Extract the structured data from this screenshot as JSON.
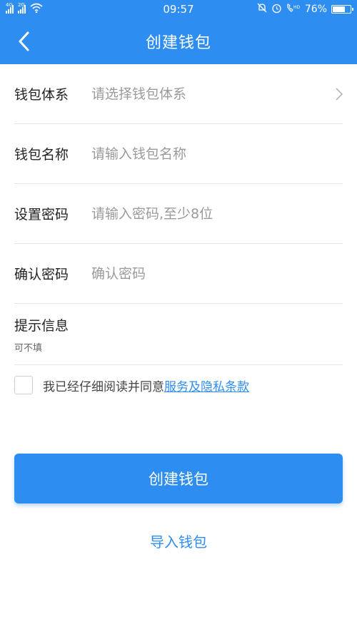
{
  "status_bar": {
    "signal_1": "4G",
    "signal_2": "2G",
    "time": "09:57",
    "battery_percent": "76%",
    "battery_level": 0.76,
    "icons": [
      "wifi-icon",
      "mute-bell-icon",
      "alarm-icon",
      "hd-call-icon",
      "battery-icon"
    ]
  },
  "nav": {
    "title": "创建钱包",
    "back_icon": "chevron-left-icon"
  },
  "form": {
    "system": {
      "label": "钱包体系",
      "placeholder": "请选择钱包体系",
      "value": ""
    },
    "name": {
      "label": "钱包名称",
      "placeholder": "请输入钱包名称",
      "value": ""
    },
    "password": {
      "label": "设置密码",
      "placeholder": "请输入密码,至少8位",
      "value": ""
    },
    "confirm": {
      "label": "确认密码",
      "placeholder": "确认密码",
      "value": ""
    },
    "hint": {
      "label": "提示信息",
      "sub": "可不填"
    }
  },
  "agreement": {
    "checked": false,
    "text": "我已经仔细阅读并同意",
    "link": "服务及隐私条款"
  },
  "actions": {
    "create": "创建钱包",
    "import": "导入钱包"
  },
  "colors": {
    "primary": "#2e8df0",
    "divider": "#e6e6e6",
    "placeholder": "#9a9a9a"
  }
}
